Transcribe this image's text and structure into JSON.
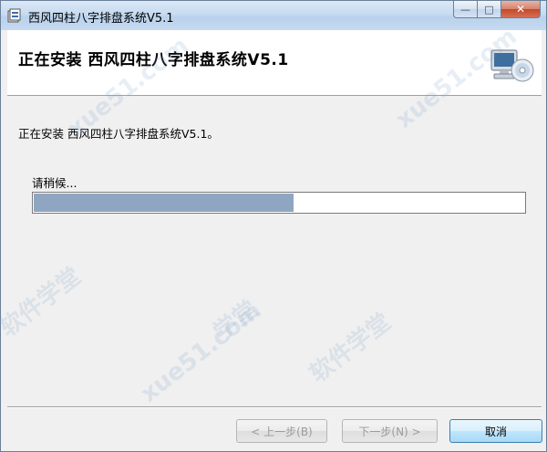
{
  "window": {
    "title": "西风四柱八字排盘系统V5.1",
    "minimize_glyph": "—",
    "maximize_glyph": "□",
    "close_glyph": "✕"
  },
  "header": {
    "title": "正在安装 西风四柱八字排盘系统V5.1",
    "image_icon": "computer-cd-icon"
  },
  "content": {
    "status_text": "正在安装 西风四柱八字排盘系统V5.1。",
    "wait_label": "请稍候...",
    "progress_fraction": 0.53
  },
  "buttons": {
    "back_label": "< 上一步(B)",
    "next_label": "下一步(N) >",
    "cancel_label": "取消"
  },
  "watermarks": [
    "xue51.com",
    "软件学堂",
    "xue51.com",
    "学堂",
    "xue51.com",
    "软件学堂"
  ],
  "colors": {
    "progress_fill": "#8fa6c2",
    "accent_border": "#3c7fb1"
  }
}
